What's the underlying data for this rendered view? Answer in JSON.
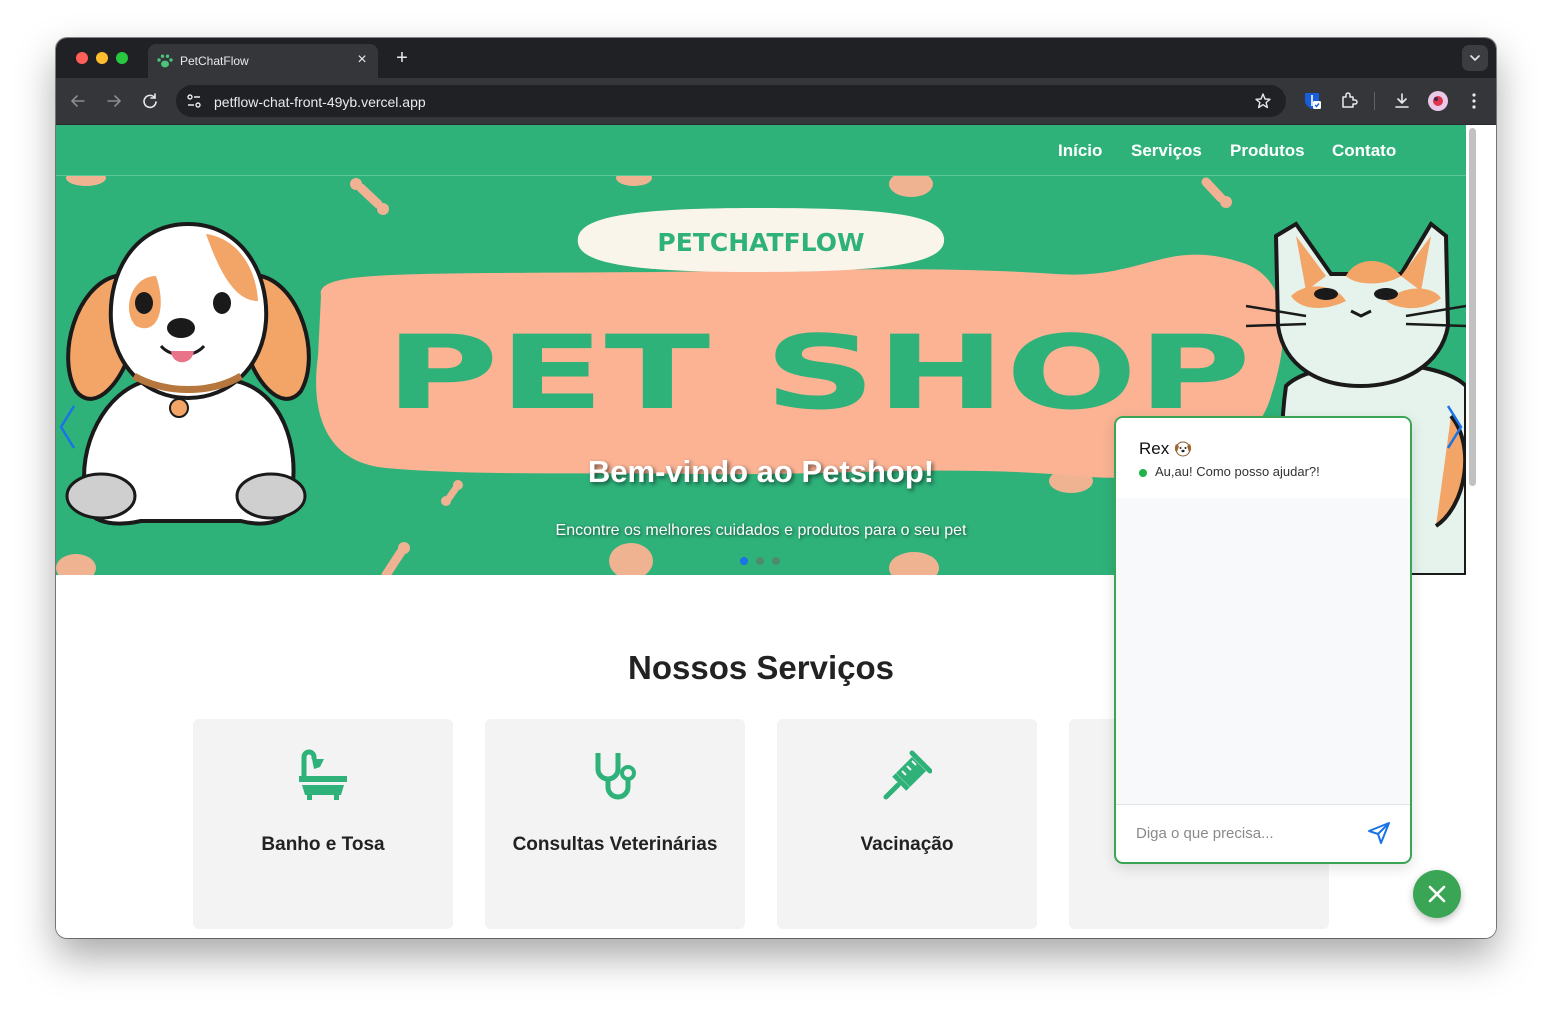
{
  "browser": {
    "tab_title": "PetChatFlow",
    "tab_close_glyph": "×",
    "new_tab_glyph": "+",
    "url": "petflow-chat-front-49yb.vercel.app",
    "icons": [
      "back-arrow-icon",
      "forward-arrow-icon",
      "reload-icon",
      "site-info-icon",
      "bookmark-star-icon",
      "bitwarden-icon",
      "extensions-icon",
      "download-icon",
      "profile-avatar-icon",
      "menu-kebab-icon",
      "tab-search-chevron-icon",
      "paw-favicon-icon"
    ]
  },
  "nav": {
    "items": [
      {
        "label": "Início"
      },
      {
        "label": "Serviços"
      },
      {
        "label": "Produtos"
      },
      {
        "label": "Contato"
      }
    ]
  },
  "hero": {
    "logo_text": "PETCHATFLOW",
    "banner_text": "PET SHOP",
    "title": "Bem-vindo ao Petshop!",
    "subtitle": "Encontre os melhores cuidados e produtos para o seu pet",
    "slides_total": 3,
    "active_slide": 1
  },
  "services": {
    "title": "Nossos Serviços",
    "items": [
      {
        "label": "Banho e Tosa",
        "icon": "bathtub-icon"
      },
      {
        "label": "Consultas Veterinárias",
        "icon": "stethoscope-icon"
      },
      {
        "label": "Vacinação",
        "icon": "syringe-icon"
      },
      {
        "label": "",
        "icon": "hidden-card"
      }
    ]
  },
  "chat": {
    "name": "Rex",
    "status": "Au,au! Como posso ajudar?!",
    "input_placeholder": "Diga o que precisa...",
    "close_glyph": "✕"
  },
  "colors": {
    "brand_green": "#2eb27a",
    "chat_green": "#3aa655",
    "peach": "#fbb394",
    "online": "#21b34b",
    "send_blue": "#1a73e8"
  }
}
